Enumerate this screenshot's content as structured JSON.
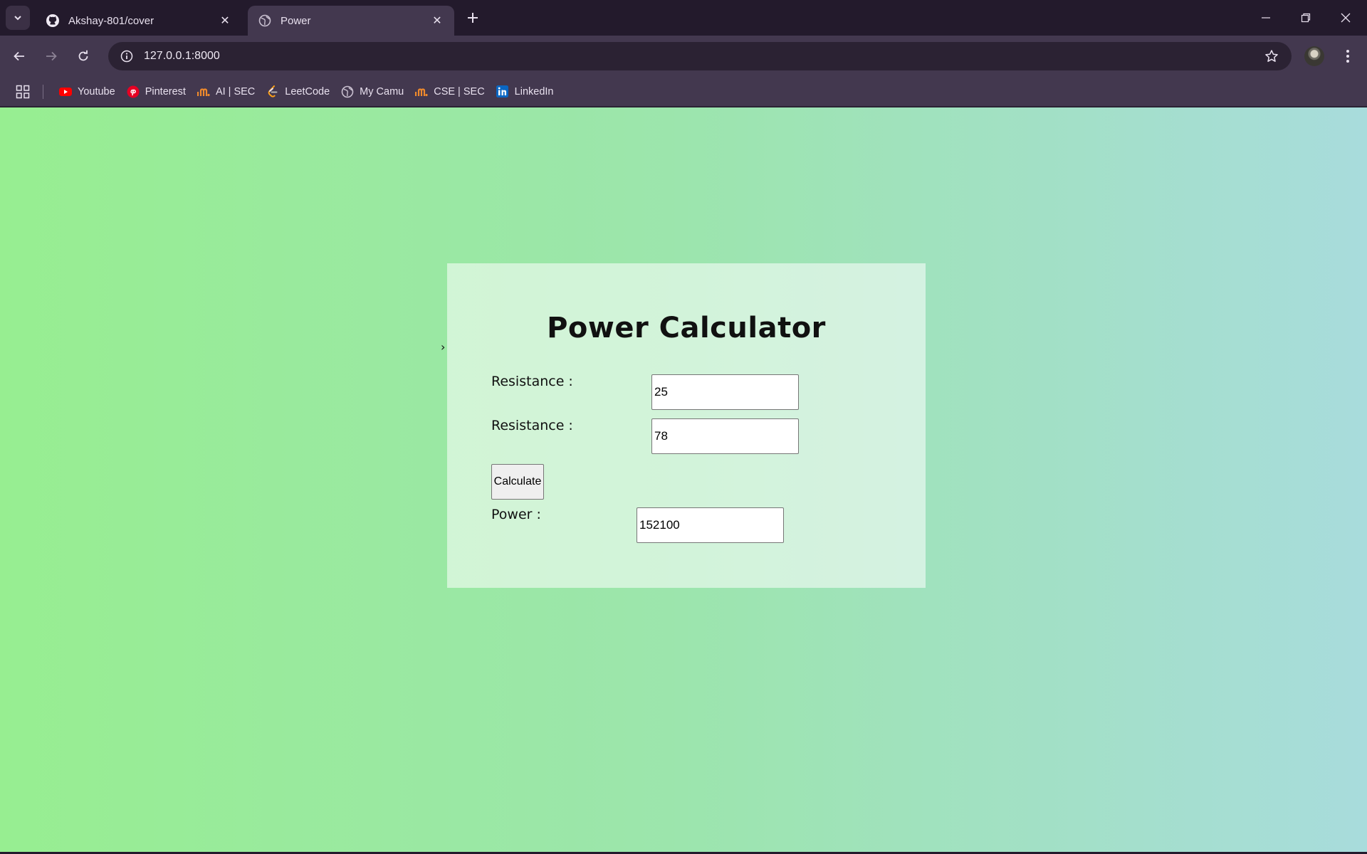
{
  "browser": {
    "tabs": [
      {
        "title": "Akshay-801/cover",
        "icon": "github-icon",
        "active": false
      },
      {
        "title": "Power",
        "icon": "globe-icon",
        "active": true
      }
    ],
    "url": "127.0.0.1:8000",
    "bookmarks": [
      {
        "label": "Youtube",
        "icon": "youtube-icon",
        "color": "#ff0000"
      },
      {
        "label": "Pinterest",
        "icon": "pinterest-icon",
        "color": "#e60023"
      },
      {
        "label": "AI | SEC",
        "icon": "camu-icon",
        "color": "#f08a2c"
      },
      {
        "label": "LeetCode",
        "icon": "leetcode-icon",
        "color": "#ffa116"
      },
      {
        "label": "My Camu",
        "icon": "globe-icon",
        "color": "#c9c0d0"
      },
      {
        "label": "CSE | SEC",
        "icon": "camu-icon",
        "color": "#f08a2c"
      },
      {
        "label": "LinkedIn",
        "icon": "linkedin-icon",
        "color": "#0a66c2"
      }
    ]
  },
  "page": {
    "title": "Power Calculator",
    "caret": "›",
    "resistance1": {
      "label": "Resistance :",
      "value": "25"
    },
    "resistance2": {
      "label": "Resistance :",
      "value": "78"
    },
    "calculate_label": "Calculate",
    "power": {
      "label": "Power :",
      "value": "152100"
    }
  },
  "colors": {
    "background_start": "#97ee91",
    "background_end": "#a8dcdc",
    "chrome_dark": "#231a2c",
    "chrome_toolbar": "#43384f"
  }
}
